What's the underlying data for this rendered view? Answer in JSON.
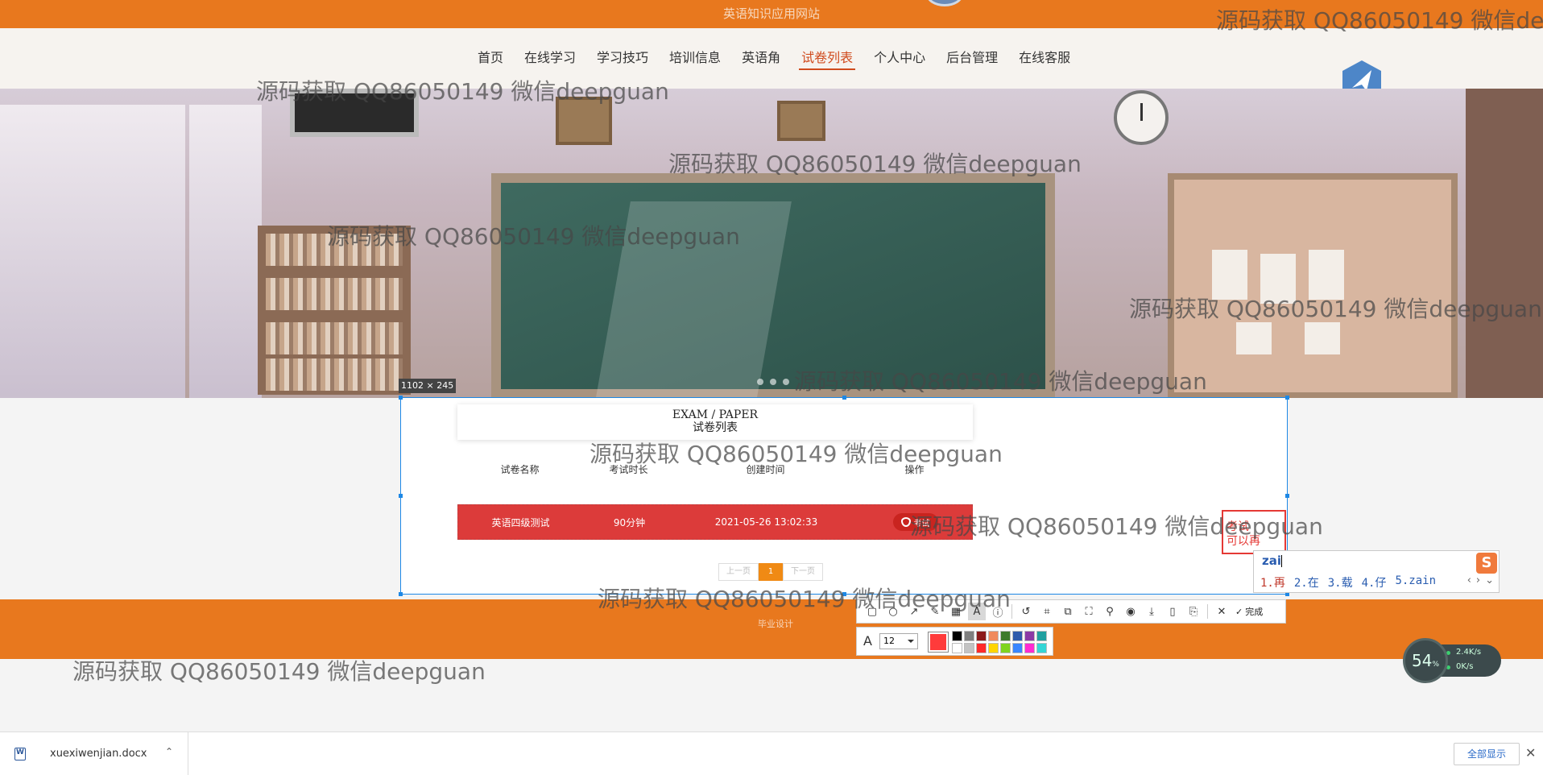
{
  "site": {
    "title": "英语知识应用网站"
  },
  "nav": {
    "items": [
      "首页",
      "在线学习",
      "学习技巧",
      "培训信息",
      "英语角",
      "试卷列表",
      "个人中心",
      "后台管理",
      "在线客服"
    ],
    "active_index": 5
  },
  "capture": {
    "size_label": "1102 × 245"
  },
  "card": {
    "title_en": "EXAM / PAPER",
    "title_zh": "试卷列表"
  },
  "table": {
    "headers": [
      "试卷名称",
      "考试时长",
      "创建时间",
      "操作"
    ],
    "rows": [
      {
        "name": "英语四级测试",
        "duration": "90分钟",
        "created": "2021-05-26 13:02:33",
        "action": "考试"
      }
    ]
  },
  "pager": {
    "prev": "上一页",
    "current": "1",
    "next": "下一页"
  },
  "footer": {
    "text": "毕业设计"
  },
  "annotation": {
    "line1": "考试",
    "line2": "可以再"
  },
  "ime": {
    "input": "zai",
    "candidates": [
      "1.再",
      "2.在",
      "3.载",
      "4.仔",
      "5.zain"
    ],
    "logo": "S"
  },
  "toolbar": {
    "icons": [
      "rect-icon",
      "ellipse-icon",
      "arrow-icon",
      "pen-icon",
      "mosaic-icon",
      "text-icon",
      "number-icon",
      "undo-icon",
      "crop-icon",
      "ocr-icon",
      "scan-icon",
      "pin-icon",
      "record-icon",
      "download-icon",
      "phone-icon",
      "bookmark-icon",
      "close-icon"
    ],
    "done_label": "完成",
    "font_size": "12",
    "current_color": "#ff3b3b",
    "palette": [
      "#000000",
      "#7f7f7f",
      "#8b1a1a",
      "#f08a5d",
      "#3d7a2c",
      "#2e5aac",
      "#8b3aa5",
      "#20a0a0",
      "#ffffff",
      "#c3c3c3",
      "#ff2a2a",
      "#ffd500",
      "#7fd420",
      "#3a86ff",
      "#ff2bd1",
      "#35d6d6"
    ]
  },
  "network": {
    "percent": "54",
    "percent_unit": "%",
    "up": "2.4K/s",
    "down": "0K/s"
  },
  "downloads": {
    "file": "xuexiwenjian.docx",
    "show_all": "全部显示"
  },
  "watermark": "源码获取 QQ86050149 微信deepguan"
}
